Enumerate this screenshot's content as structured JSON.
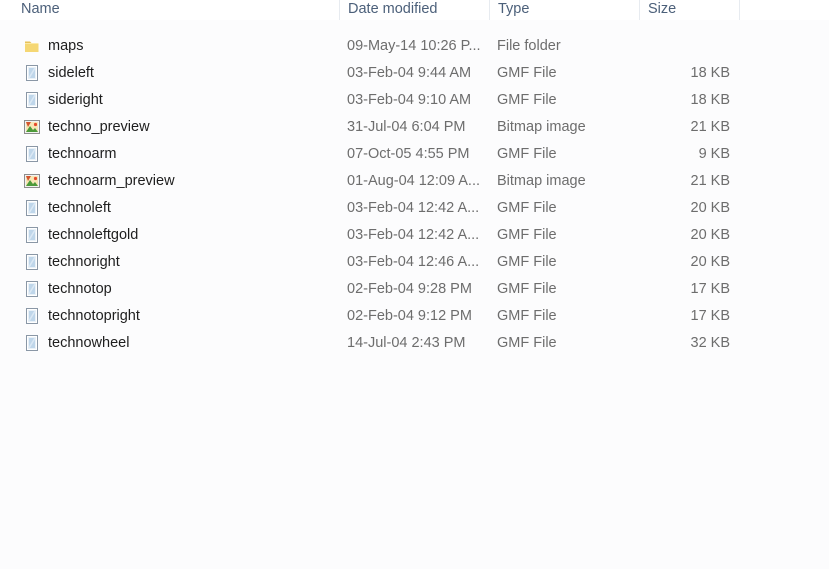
{
  "columns": {
    "name": "Name",
    "date": "Date modified",
    "type": "Type",
    "size": "Size"
  },
  "files": [
    {
      "name": "maps",
      "date": "09-May-14 10:26 P...",
      "type": "File folder",
      "size": "",
      "icon": "folder-icon"
    },
    {
      "name": "sideleft",
      "date": "03-Feb-04 9:44 AM",
      "type": "GMF File",
      "size": "18 KB",
      "icon": "gmf-file-icon"
    },
    {
      "name": "sideright",
      "date": "03-Feb-04 9:10 AM",
      "type": "GMF File",
      "size": "18 KB",
      "icon": "gmf-file-icon"
    },
    {
      "name": "techno_preview",
      "date": "31-Jul-04 6:04 PM",
      "type": "Bitmap image",
      "size": "21 KB",
      "icon": "bitmap-image-icon"
    },
    {
      "name": "technoarm",
      "date": "07-Oct-05 4:55 PM",
      "type": "GMF File",
      "size": "9 KB",
      "icon": "gmf-file-icon"
    },
    {
      "name": "technoarm_preview",
      "date": "01-Aug-04 12:09 A...",
      "type": "Bitmap image",
      "size": "21 KB",
      "icon": "bitmap-image-icon"
    },
    {
      "name": "technoleft",
      "date": "03-Feb-04 12:42 A...",
      "type": "GMF File",
      "size": "20 KB",
      "icon": "gmf-file-icon"
    },
    {
      "name": "technoleftgold",
      "date": "03-Feb-04 12:42 A...",
      "type": "GMF File",
      "size": "20 KB",
      "icon": "gmf-file-icon"
    },
    {
      "name": "technoright",
      "date": "03-Feb-04 12:46 A...",
      "type": "GMF File",
      "size": "20 KB",
      "icon": "gmf-file-icon"
    },
    {
      "name": "technotop",
      "date": "02-Feb-04 9:28 PM",
      "type": "GMF File",
      "size": "17 KB",
      "icon": "gmf-file-icon"
    },
    {
      "name": "technotopright",
      "date": "02-Feb-04 9:12 PM",
      "type": "GMF File",
      "size": "17 KB",
      "icon": "gmf-file-icon"
    },
    {
      "name": "technowheel",
      "date": "14-Jul-04 2:43 PM",
      "type": "GMF File",
      "size": "32 KB",
      "icon": "gmf-file-icon"
    }
  ]
}
